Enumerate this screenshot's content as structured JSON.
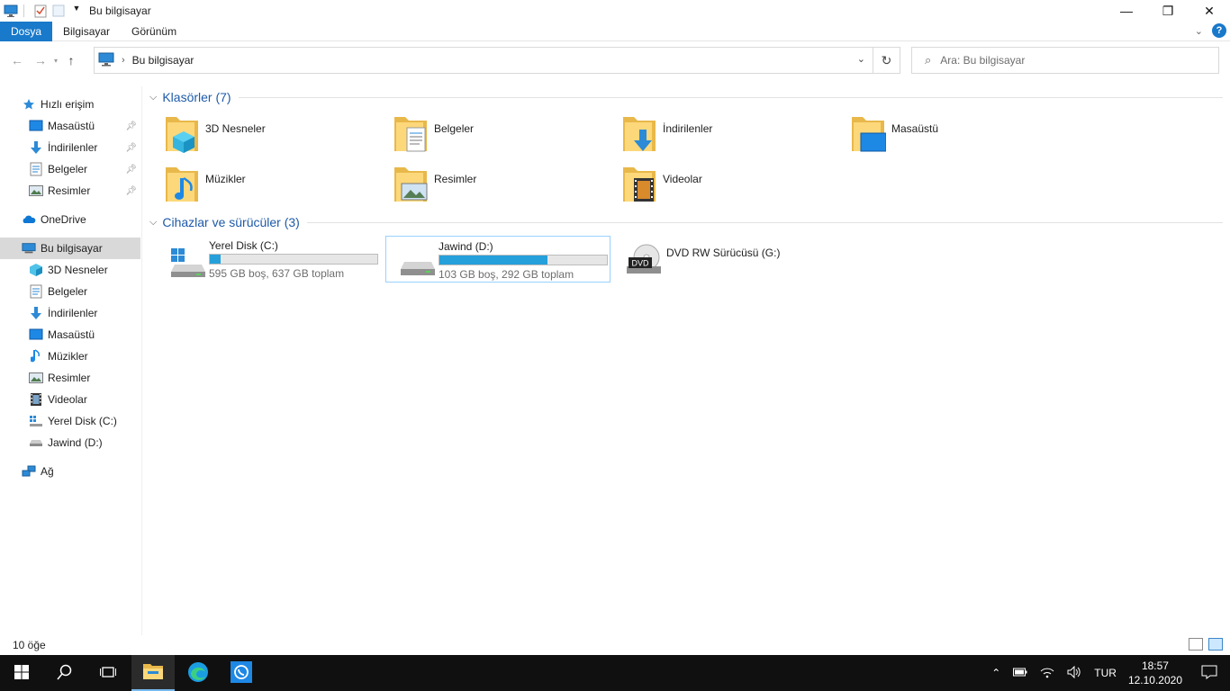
{
  "window": {
    "title": "Bu bilgisayar",
    "controls": {
      "minimize": "—",
      "maximize": "❐",
      "close": "✕"
    }
  },
  "ribbon": {
    "tabs": [
      "Dosya",
      "Bilgisayar",
      "Görünüm"
    ],
    "help": "?"
  },
  "address": {
    "crumb": "Bu bilgisayar",
    "search_placeholder": "Ara: Bu bilgisayar"
  },
  "navpane": {
    "quick_access": "Hızlı erişim",
    "quick_items": [
      {
        "label": "Masaüstü",
        "icon": "desktop-icon"
      },
      {
        "label": "İndirilenler",
        "icon": "downloads-icon"
      },
      {
        "label": "Belgeler",
        "icon": "documents-icon"
      },
      {
        "label": "Resimler",
        "icon": "pictures-icon"
      }
    ],
    "onedrive": "OneDrive",
    "this_pc": "Bu bilgisayar",
    "pc_items": [
      {
        "label": "3D Nesneler",
        "icon": "3d-objects-icon"
      },
      {
        "label": "Belgeler",
        "icon": "documents-icon"
      },
      {
        "label": "İndirilenler",
        "icon": "downloads-icon"
      },
      {
        "label": "Masaüstü",
        "icon": "desktop-icon"
      },
      {
        "label": "Müzikler",
        "icon": "music-icon"
      },
      {
        "label": "Resimler",
        "icon": "pictures-icon"
      },
      {
        "label": "Videolar",
        "icon": "videos-icon"
      },
      {
        "label": "Yerel Disk (C:)",
        "icon": "drive-c-icon"
      },
      {
        "label": "Jawind (D:)",
        "icon": "drive-d-icon"
      }
    ],
    "network": "Ağ"
  },
  "content": {
    "folders_header": "Klasörler (7)",
    "folders": [
      {
        "label": "3D Nesneler",
        "icon": "3d-objects-folder-icon"
      },
      {
        "label": "Belgeler",
        "icon": "documents-folder-icon"
      },
      {
        "label": "İndirilenler",
        "icon": "downloads-folder-icon"
      },
      {
        "label": "Masaüstü",
        "icon": "desktop-folder-icon"
      },
      {
        "label": "Müzikler",
        "icon": "music-folder-icon"
      },
      {
        "label": "Resimler",
        "icon": "pictures-folder-icon"
      },
      {
        "label": "Videolar",
        "icon": "videos-folder-icon"
      }
    ],
    "drives_header": "Cihazlar ve sürücüler (3)",
    "drives": [
      {
        "name": "Yerel Disk (C:)",
        "info": "595 GB boş, 637 GB toplam",
        "used_fraction": 0.066
      },
      {
        "name": "Jawind (D:)",
        "info": "103 GB boş, 292 GB toplam",
        "used_fraction": 0.647
      },
      {
        "name": "DVD RW Sürücüsü (G:)",
        "dvd_label": "DVD"
      }
    ]
  },
  "status": {
    "count": "10 öğe"
  },
  "taskbar": {
    "language": "TUR",
    "time": "18:57",
    "date": "12.10.2020"
  },
  "colors": {
    "accent": "#1979ca",
    "drive_bar": "#26a0da",
    "header_text": "#1e5aa8"
  }
}
